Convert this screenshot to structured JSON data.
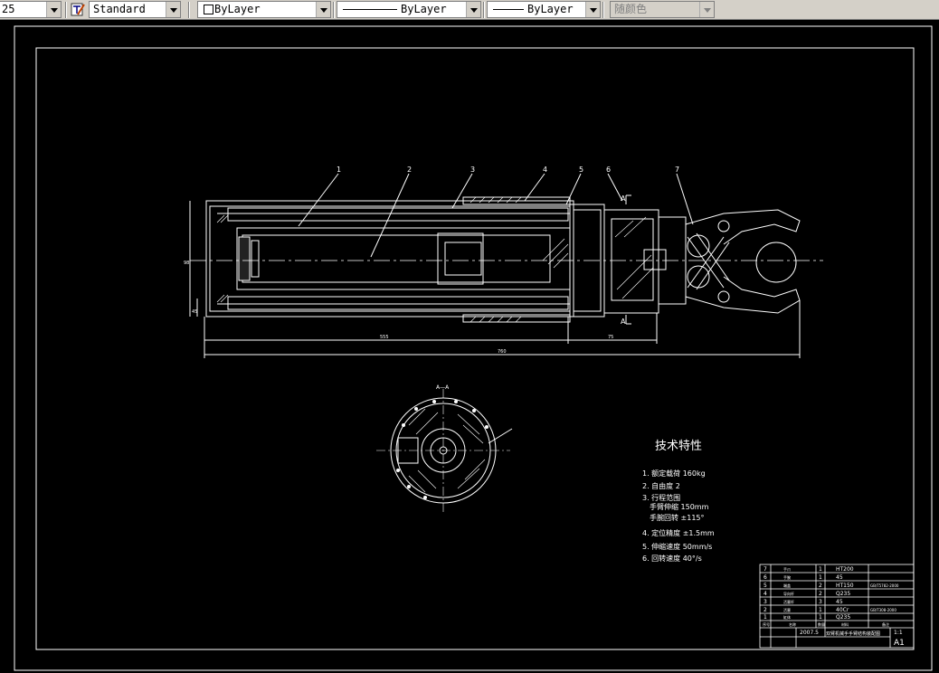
{
  "toolbar": {
    "scale_value": "25",
    "text_style": "Standard",
    "layer": "ByLayer",
    "linetype": "ByLayer",
    "lineweight": "ByLayer",
    "plot_color": "随颜色"
  },
  "drawing": {
    "part_numbers": [
      "1",
      "2",
      "3",
      "4",
      "5",
      "6",
      "7"
    ],
    "section_label": "A—A",
    "section_marker": "A",
    "dimensions": [
      "555",
      "75",
      "760",
      "98",
      "45"
    ],
    "sheet_size": "A1"
  },
  "tech": {
    "title": "技术特性",
    "items": [
      "1. 额定载荷 160kg",
      "2. 自由度 2",
      "3. 行程范围",
      "手臂伸缩 150mm",
      "手腕回转 ±115°",
      "4. 定位精度 ±1.5mm",
      "5. 伸缩速度 50mm/s",
      "6. 回转速度 40°/s"
    ]
  },
  "bom": {
    "rows": [
      {
        "no": "7",
        "name": "手爪",
        "qty": "1",
        "material": "HT200",
        "std": ""
      },
      {
        "no": "6",
        "name": "手腕",
        "qty": "1",
        "material": "45",
        "std": ""
      },
      {
        "no": "5",
        "name": "端盖",
        "qty": "2",
        "material": "HT150",
        "std": "GB/T5782-2000"
      },
      {
        "no": "4",
        "name": "导向杆",
        "qty": "2",
        "material": "Q235",
        "std": ""
      },
      {
        "no": "3",
        "name": "活塞杆",
        "qty": "3",
        "material": "45",
        "std": ""
      },
      {
        "no": "2",
        "name": "活塞",
        "qty": "1",
        "material": "40Cr",
        "std": "GB/T308-2000"
      },
      {
        "no": "1",
        "name": "缸体",
        "qty": "1",
        "material": "Q235",
        "std": ""
      }
    ],
    "header": [
      "序号",
      "名称",
      "数量",
      "材料",
      "备注"
    ],
    "date": "2007.5",
    "title": "双臂机械手手臂结构装配图",
    "scale": "1:1"
  },
  "colors": {
    "canvas": "#000000",
    "lines": "#ffffff",
    "toolbar": "#d4d0c8"
  }
}
